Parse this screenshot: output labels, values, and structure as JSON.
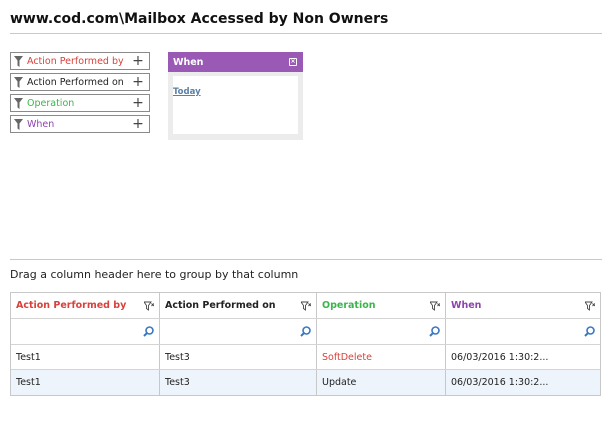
{
  "page": {
    "title": "www.cod.com\\Mailbox Accessed by Non Owners"
  },
  "colors": {
    "action_performed_by": "#d9413a",
    "action_performed_on": "#222222",
    "operation": "#3cb44b",
    "when": "#8e44ad",
    "panel_header": "#9b59b6",
    "link": "#5a7fa8",
    "search_icon": "#3a78c2"
  },
  "filters": [
    {
      "label": "Action Performed by",
      "icon": "filter-icon",
      "action": "plus-icon"
    },
    {
      "label": "Action Performed on",
      "icon": "filter-icon",
      "action": "plus-icon"
    },
    {
      "label": "Operation",
      "icon": "filter-icon",
      "action": "plus-icon"
    },
    {
      "label": "When",
      "icon": "filter-icon",
      "action": "plus-icon"
    }
  ],
  "when_panel": {
    "title": "When",
    "close_icon": "close-icon",
    "link": "Today"
  },
  "group_hint": "Drag a column header here to group by that column",
  "grid": {
    "columns": [
      {
        "label": "Action Performed by"
      },
      {
        "label": "Action Performed on"
      },
      {
        "label": "Operation"
      },
      {
        "label": "When"
      }
    ],
    "rows": [
      [
        "Test1",
        "Test3",
        "SoftDelete",
        "06/03/2016 1:30:2..."
      ],
      [
        "Test1",
        "Test3",
        "Update",
        "06/03/2016 1:30:2..."
      ]
    ]
  }
}
